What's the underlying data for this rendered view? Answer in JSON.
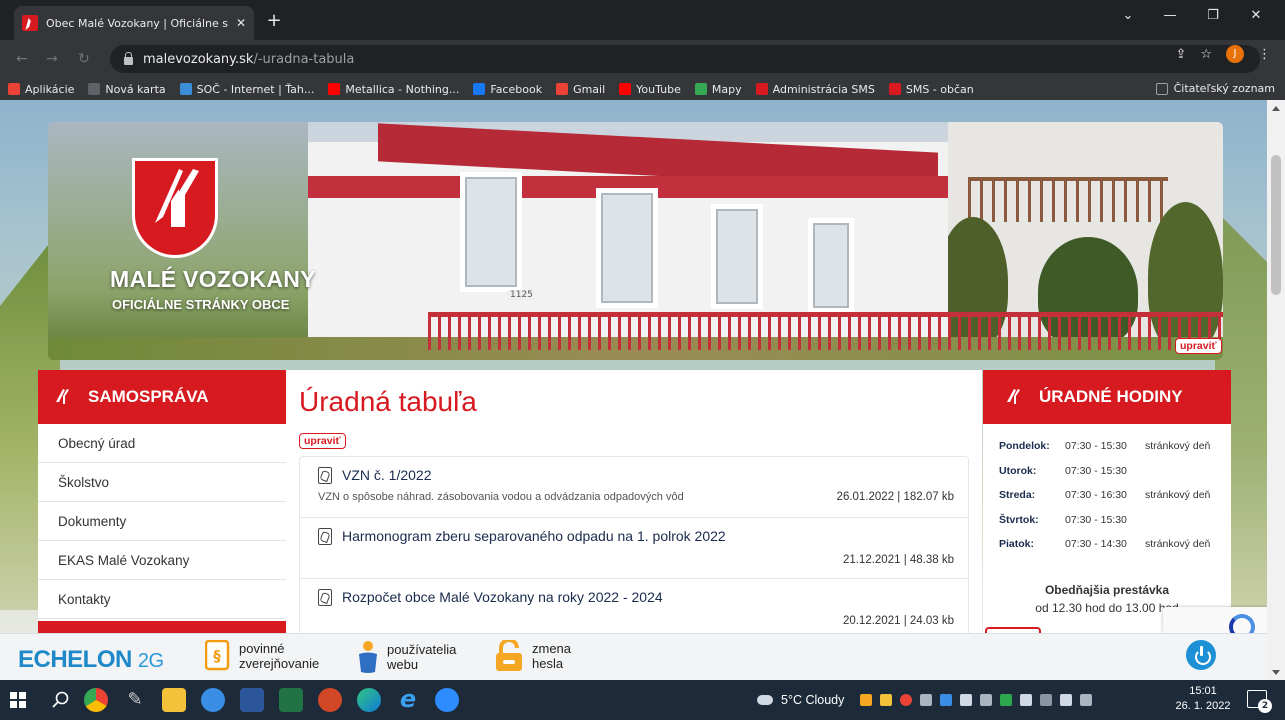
{
  "browser": {
    "tab_title": "Obec Malé Vozokany | Oficiálne s",
    "url_host": "malevozokany.sk",
    "url_path": "/-uradna-tabula",
    "avatar_letter": "J",
    "bookmarks": [
      {
        "label": "Aplikácie",
        "color": "#ea4335"
      },
      {
        "label": "Nová karta",
        "color": "#5f6368"
      },
      {
        "label": "SOČ - Internet | Ťah...",
        "color": "#3c8dd8"
      },
      {
        "label": "Metallica - Nothing...",
        "color": "#ff0000"
      },
      {
        "label": "Facebook",
        "color": "#1877f2"
      },
      {
        "label": "Gmail",
        "color": "#ea4335"
      },
      {
        "label": "YouTube",
        "color": "#ff0000"
      },
      {
        "label": "Mapy",
        "color": "#34a853"
      },
      {
        "label": "Administrácia SMS",
        "color": "#d71920"
      },
      {
        "label": "SMS - občan",
        "color": "#d71920"
      }
    ],
    "reading_list": "Čitateľský zoznam"
  },
  "banner": {
    "title": "MALÉ VOZOKANY",
    "subtitle": "OFICIÁLNE STRÁNKY OBCE",
    "edit": "upraviť",
    "house_number": "1125"
  },
  "sidebar": {
    "heading": "SAMOSPRÁVA",
    "items": [
      {
        "label": "Obecný úrad"
      },
      {
        "label": "Školstvo"
      },
      {
        "label": "Dokumenty"
      },
      {
        "label": "EKAS Malé Vozokany"
      },
      {
        "label": "Kontakty"
      }
    ]
  },
  "main": {
    "title": "Úradná tabuľa",
    "edit": "upraviť",
    "documents": [
      {
        "title": "VZN č. 1/2022",
        "desc": "VZN o spôsobe náhrad. zásobovania vodou a odvádzania odpadových vôd",
        "meta": "26.01.2022 | 182.07 kb"
      },
      {
        "title": "Harmonogram zberu separovaného odpadu na 1. polrok 2022",
        "desc": "",
        "meta": "21.12.2021 | 48.38 kb"
      },
      {
        "title": "Rozpočet obce Malé Vozokany na roky 2022 - 2024",
        "desc": "",
        "meta": "20.12.2021 | 24.03 kb"
      }
    ]
  },
  "hours": {
    "heading": "ÚRADNÉ HODINY",
    "rows": [
      {
        "day": "Pondelok:",
        "time": "07:30 - 15:30",
        "note": "stránkový deň"
      },
      {
        "day": "Utorok:",
        "time": "07:30 - 15:30",
        "note": ""
      },
      {
        "day": "Streda:",
        "time": "07:30 - 16:30",
        "note": "stránkový deň"
      },
      {
        "day": "Štvrtok:",
        "time": "07:30 - 15:30",
        "note": ""
      },
      {
        "day": "Piatok:",
        "time": "07:30 - 14:30",
        "note": "stránkový deň"
      }
    ],
    "lunch_heading": "Obedňajšia prestávka",
    "lunch_time": "od 12.30 hod do 13.00 hod"
  },
  "echelon": {
    "logo": "ECHELON",
    "logo_suffix": "2G",
    "items": [
      {
        "line1": "povinné",
        "line2": "zverejňovanie"
      },
      {
        "line1": "používatelia",
        "line2": "webu"
      },
      {
        "line1": "zmena",
        "line2": "hesla"
      }
    ]
  },
  "taskbar": {
    "weather": "5°C  Cloudy",
    "time": "15:01",
    "date": "26. 1. 2022",
    "notifications": "2"
  }
}
